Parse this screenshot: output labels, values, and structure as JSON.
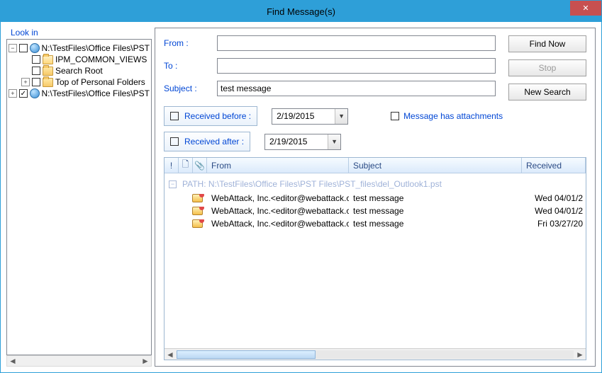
{
  "window": {
    "title": "Find Message(s)"
  },
  "tree": {
    "label": "Look in",
    "nodes": [
      {
        "expand": "−",
        "checked": false,
        "icon": "pst",
        "text": "N:\\TestFiles\\Office Files\\PST",
        "depth": 0
      },
      {
        "expand": "",
        "checked": false,
        "icon": "folder-open",
        "text": "IPM_COMMON_VIEWS",
        "depth": 1
      },
      {
        "expand": "",
        "checked": false,
        "icon": "folder",
        "text": "Search Root",
        "depth": 1
      },
      {
        "expand": "+",
        "checked": false,
        "icon": "folder",
        "text": "Top of Personal Folders",
        "depth": 1
      },
      {
        "expand": "+",
        "checked": true,
        "icon": "pst",
        "text": "N:\\TestFiles\\Office Files\\PST",
        "depth": 0
      }
    ]
  },
  "form": {
    "from_label": "From :",
    "from_value": "",
    "to_label": "To :",
    "to_value": "",
    "subject_label": "Subject :",
    "subject_value": "test message",
    "received_before_label": "Received before :",
    "received_before_date": "2/19/2015",
    "received_after_label": "Received after :",
    "received_after_date": "2/19/2015",
    "attachments_label": "Message has attachments"
  },
  "buttons": {
    "find_now": "Find Now",
    "stop": "Stop",
    "new_search": "New Search"
  },
  "results": {
    "headers": {
      "flag": "!",
      "type": "🗋",
      "attach": "📎",
      "from": "From",
      "subject": "Subject",
      "received": "Received"
    },
    "path_label": "PATH:  N:\\TestFiles\\Office Files\\PST Files\\PST_files\\del_Outlook1.pst",
    "rows": [
      {
        "from": "WebAttack, Inc.<editor@webattack.c...",
        "subject": "test message",
        "received": "Wed 04/01/2"
      },
      {
        "from": "WebAttack, Inc.<editor@webattack.c...",
        "subject": "test message",
        "received": "Wed 04/01/2"
      },
      {
        "from": "WebAttack, Inc.<editor@webattack.c...",
        "subject": "test message",
        "received": "Fri 03/27/20"
      }
    ]
  }
}
